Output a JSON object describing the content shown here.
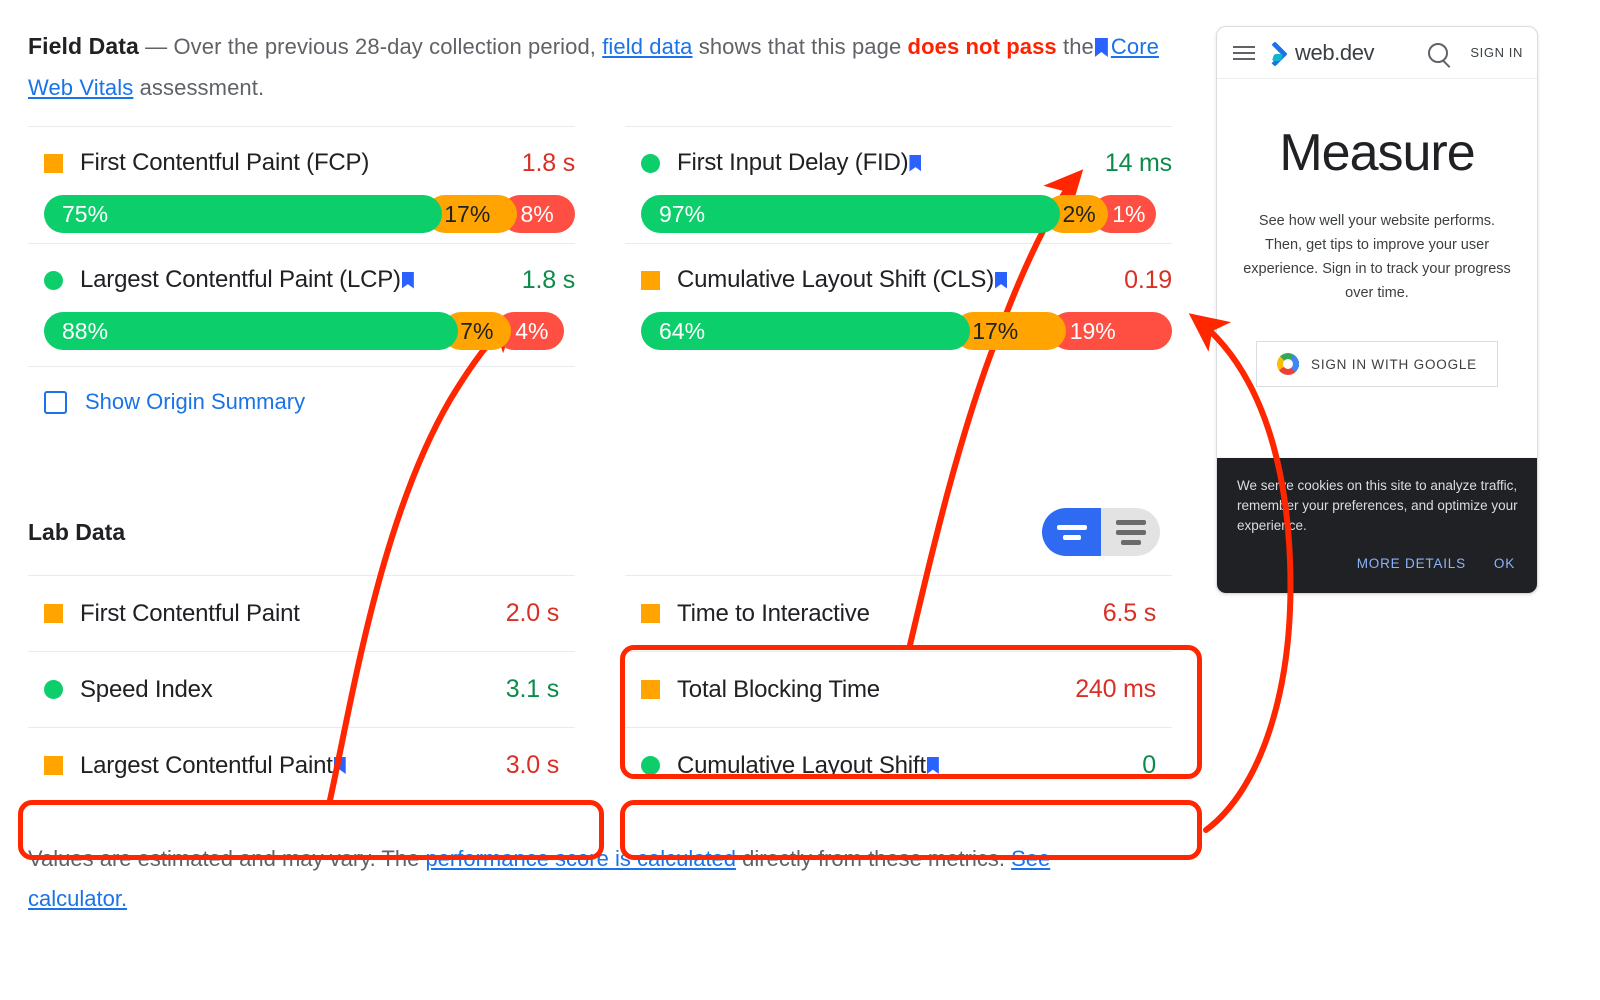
{
  "field_data": {
    "title": "Field Data",
    "dash": "—",
    "intro_part1": "Over the previous 28-day collection period,",
    "link_field_data": "field data",
    "intro_part2": "shows that this page",
    "fail_text": "does not pass",
    "intro_part3": "the",
    "link_cwv": "Core Web Vitals",
    "intro_part4": "assessment.",
    "metrics": [
      {
        "name": "First Contentful Paint (FCP)",
        "value": "1.8 s",
        "status": "average",
        "value_color": "#d93025",
        "bookmark": false,
        "good": "75%",
        "avg": "17%",
        "poor": "8%"
      },
      {
        "name": "First Input Delay (FID)",
        "value": "14 ms",
        "status": "good",
        "value_color": "#0c8b4a",
        "bookmark": true,
        "good": "97%",
        "avg": "2%",
        "poor": "1%"
      },
      {
        "name": "Largest Contentful Paint (LCP)",
        "value": "1.8 s",
        "status": "good",
        "value_color": "#0c8b4a",
        "bookmark": true,
        "good": "88%",
        "avg": "7%",
        "poor": "4%"
      },
      {
        "name": "Cumulative Layout Shift (CLS)",
        "value": "0.19",
        "status": "average",
        "value_color": "#d93025",
        "bookmark": true,
        "good": "64%",
        "avg": "17%",
        "poor": "19%"
      }
    ],
    "origin_summary_label": "Show Origin Summary"
  },
  "lab_data": {
    "title": "Lab Data",
    "view_toggle": {
      "selected": "compact",
      "options": [
        "compact",
        "detailed"
      ]
    },
    "rows": [
      {
        "name": "First Contentful Paint",
        "value": "2.0 s",
        "status": "average",
        "value_color": "#d93025",
        "bookmark": false
      },
      {
        "name": "Time to Interactive",
        "value": "6.5 s",
        "status": "average",
        "value_color": "#d93025",
        "bookmark": false
      },
      {
        "name": "Speed Index",
        "value": "3.1 s",
        "status": "good",
        "value_color": "#0c8b4a",
        "bookmark": false
      },
      {
        "name": "Total Blocking Time",
        "value": "240 ms",
        "status": "average",
        "value_color": "#d93025",
        "bookmark": false
      },
      {
        "name": "Largest Contentful Paint",
        "value": "3.0 s",
        "status": "average",
        "value_color": "#d93025",
        "bookmark": true
      },
      {
        "name": "Cumulative Layout Shift",
        "value": "0",
        "status": "good",
        "value_color": "#0c8b4a",
        "bookmark": true
      }
    ]
  },
  "footer": {
    "part1": "Values are estimated and may vary. The",
    "link1": "performance score is calculated",
    "part2": "directly from these metrics.",
    "link2": "See calculator."
  },
  "phone": {
    "brand": "web.dev",
    "sign_in": "SIGN IN",
    "heading": "Measure",
    "subtext": "See how well your website performs. Then, get tips to improve your user experience. Sign in to track your progress over time.",
    "google_button": "SIGN IN WITH GOOGLE",
    "cookie_text": "We serve cookies on this site to analyze traffic, remember your preferences, and optimize your experience.",
    "cookie_more": "MORE DETAILS",
    "cookie_ok": "OK"
  },
  "annotations": {
    "color": "#ff2600",
    "boxes": [
      {
        "id": "lab-lcp-box",
        "label": "Largest Contentful Paint lab row highlight"
      },
      {
        "id": "lab-tti-tbt-box",
        "label": "Time to Interactive and Total Blocking Time highlight"
      },
      {
        "id": "lab-cls-box",
        "label": "Cumulative Layout Shift lab row highlight"
      }
    ],
    "arrows": [
      {
        "id": "arrow-lcp",
        "from": "lab-lcp-box",
        "to": "field-lcp-value"
      },
      {
        "id": "arrow-tbt",
        "from": "lab-tti-tbt-box",
        "to": "field-fid-value"
      },
      {
        "id": "arrow-cls",
        "from": "lab-cls-box",
        "to": "field-cls-value"
      }
    ]
  }
}
